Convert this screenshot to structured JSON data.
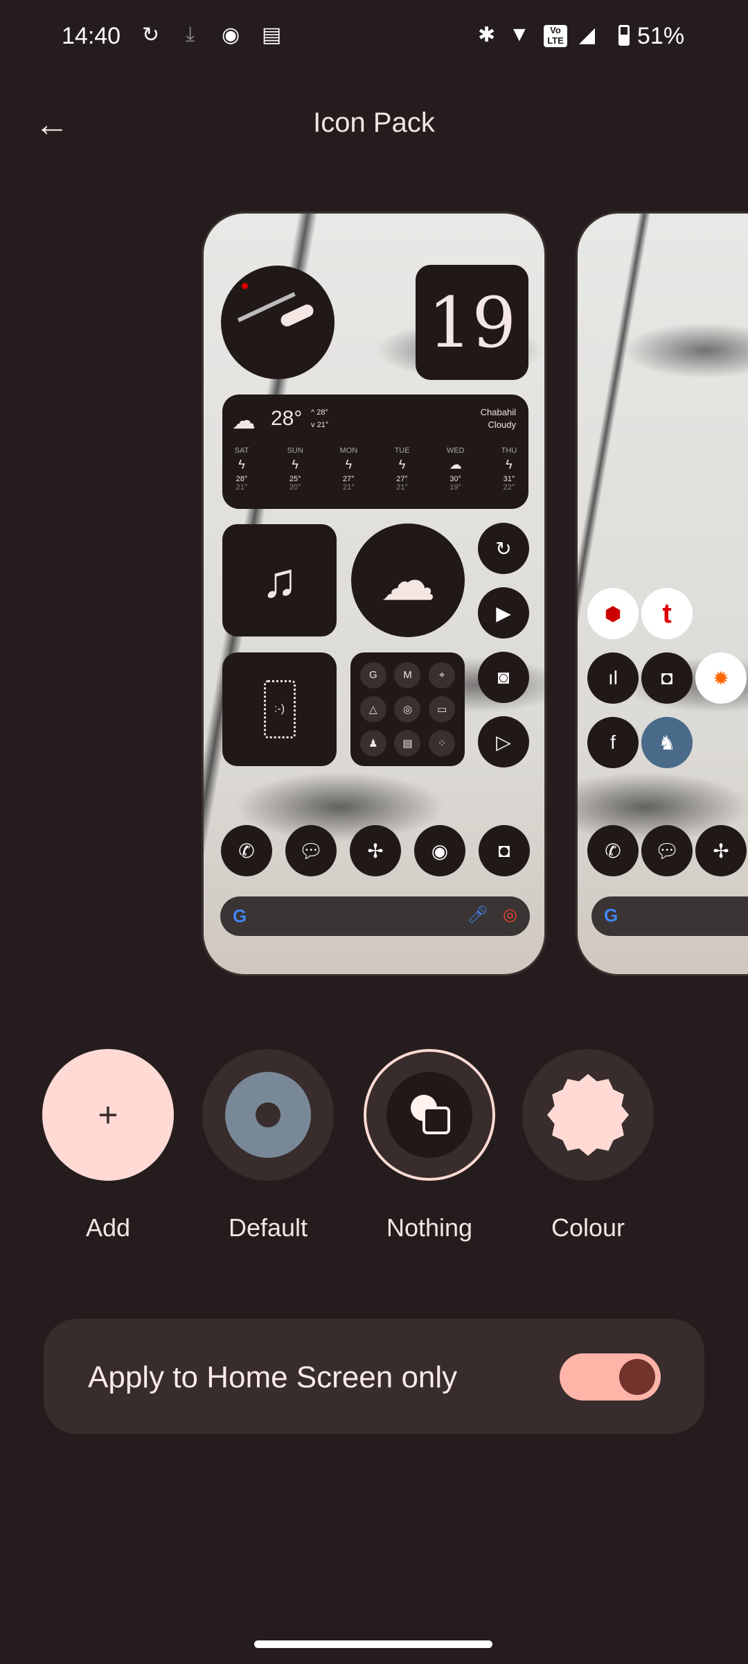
{
  "status_bar": {
    "time": "14:40",
    "battery": "51%",
    "icons": [
      "sync-icon",
      "download-icon",
      "chrome-icon",
      "news-icon",
      "bluetooth-icon",
      "wifi-icon",
      "volte-icon",
      "signal-icon",
      "battery-icon"
    ],
    "volte": "Vo LTE"
  },
  "header": {
    "title": "Icon Pack",
    "back_icon": "arrow-left-icon"
  },
  "preview": {
    "date": "19",
    "weather": {
      "temp": "28°",
      "high": "28°",
      "low": "21°",
      "location": "Chabahil",
      "condition": "Cloudy",
      "days": [
        {
          "d": "SAT",
          "h": "28°",
          "l": "21°"
        },
        {
          "d": "SUN",
          "h": "25°",
          "l": "20°"
        },
        {
          "d": "MON",
          "h": "27°",
          "l": "21°"
        },
        {
          "d": "TUE",
          "h": "27°",
          "l": "21°"
        },
        {
          "d": "WED",
          "h": "30°",
          "l": "19°"
        },
        {
          "d": "THU",
          "h": "31°",
          "l": "22°"
        }
      ]
    },
    "folder_apps": [
      "G",
      "M",
      "⌖",
      "△",
      "◎",
      "▭",
      "♟",
      "▤",
      "⁘"
    ],
    "side_icons": [
      "sync-icon",
      "youtube-icon",
      "instagram-icon",
      "play-store-icon"
    ],
    "dock": [
      "phone-icon",
      "messages-icon",
      "pinwheel-icon",
      "chrome-icon",
      "camera-icon"
    ],
    "search_g": "G"
  },
  "options": [
    {
      "label": "Add"
    },
    {
      "label": "Default"
    },
    {
      "label": "Nothing",
      "selected": true
    },
    {
      "label": "Colour"
    }
  ],
  "setting": {
    "label": "Apply to Home Screen only",
    "enabled": true
  },
  "colors": {
    "bg": "#251d1d",
    "accent": "#ffb4a8",
    "surface": "#382c2c",
    "pink": "#ffdad4"
  }
}
